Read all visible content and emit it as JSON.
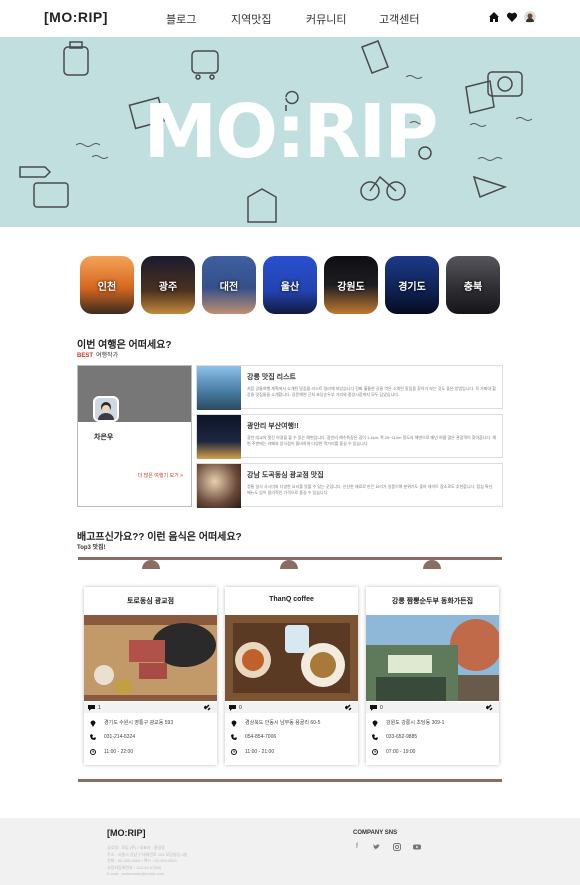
{
  "header": {
    "logo": "[MO:RIP]",
    "nav": [
      "블로그",
      "지역맛집",
      "커뮤니티",
      "고객센터"
    ],
    "icons": [
      "home-icon",
      "heart-icon",
      "user-avatar-icon"
    ]
  },
  "hero": {
    "title": "MO:RIP"
  },
  "regions": [
    {
      "label": "인천",
      "color": "#d5671e"
    },
    {
      "label": "광주",
      "color": "#3a2a1f"
    },
    {
      "label": "대전",
      "color": "#34508a"
    },
    {
      "label": "울산",
      "color": "#2243b0"
    },
    {
      "label": "강원도",
      "color": "#1d1d22"
    },
    {
      "label": "경기도",
      "color": "#0f2152"
    },
    {
      "label": "충북",
      "color": "#2f2f33"
    }
  ],
  "travel": {
    "title": "이번 여행은 어떠세요?",
    "badge": "BEST",
    "subtitle": "여행작가",
    "profile": {
      "name": "차은우",
      "more": "더 많은 여행기 보기 >"
    },
    "posts": [
      {
        "title": "강릉 맛집 리스트",
        "desc": "처음 강릉여행 계획에서 소개된 맛집을 리스트 정리해 보았습니다 진짜 훌륭한 강릉 먹은 소개된 맛집을 찾아가 보는 것도 좋은 방법입니다. 꼭 가봐야 할 강릉 맛집들을 소개합니다. 강문해변 근처 초당순두부 거리와 중앙시장까지 모두 담았습니다.",
        "color": "#4a7fa8"
      },
      {
        "title": "광안리 부산여행!!",
        "desc": "광안 대교의 멋진 야경을 볼 수 있는 해변입니다. 광안리 해수욕장은 길이 1.4km, 폭 25~110m 정도의 해변으로 매년 여름 많은 관광객이 찾아옵니다. 해변 주변에는 카페와 음식점이 즐비하여 다양한 먹거리를 즐길 수 있습니다.",
        "color": "#1c2740"
      },
      {
        "title": "강남 도곡동심 광교점 맛집",
        "desc": "정통 일식 사시미와 다양한 요리를 맛볼 수 있는 곳입니다. 신선한 재료로 만든 요리가 일품이며 분위기도 좋아 데이트 장소로도 추천합니다. 점심 특선 메뉴도 있어 합리적인 가격으로 즐길 수 있습니다.",
        "color": "#6b4a3a"
      }
    ]
  },
  "food": {
    "title": "배고프신가요?? 이런 음식은 어떠세요?",
    "subtitle": "Top3 맛집!",
    "cards": [
      {
        "name": "토로동심 광교점",
        "likes": "1",
        "address": "경기도 수원시 영통구 광교동 593",
        "phone": "031-214-6324",
        "hours": "11:00 - 22:00",
        "color": "#8a5a3f"
      },
      {
        "name": "ThanQ coffee",
        "likes": "0",
        "address": "경상북도 안동시 남부동 용골리 60-5",
        "phone": "054-854-7006",
        "hours": "11:00 - 21:00",
        "color": "#7b5533"
      },
      {
        "name": "강릉 짬뽕순두부 동화가든집",
        "likes": "0",
        "address": "강원도 강릉시 초당동 309-1",
        "phone": "033-652-9885",
        "hours": "07:00 - 19:00",
        "color": "#5f7a5a"
      }
    ]
  },
  "footer": {
    "logo": "[MO:RIP]",
    "info": [
      "상호명 : 모립 (주) / 대표자 : 홍길동",
      "주소 : 서울시 강남구 테헤란로 123 모립빌딩 5층",
      "전화 : 02-000-0000 / 팩스 : 02-000-0001",
      "사업자등록번호 : 123-45-67890",
      "E-mail : webmaster@morip.com"
    ],
    "sns_title": "COMPANY SNS",
    "sns": [
      "facebook-icon",
      "twitter-icon",
      "instagram-icon",
      "youtube-icon"
    ]
  }
}
